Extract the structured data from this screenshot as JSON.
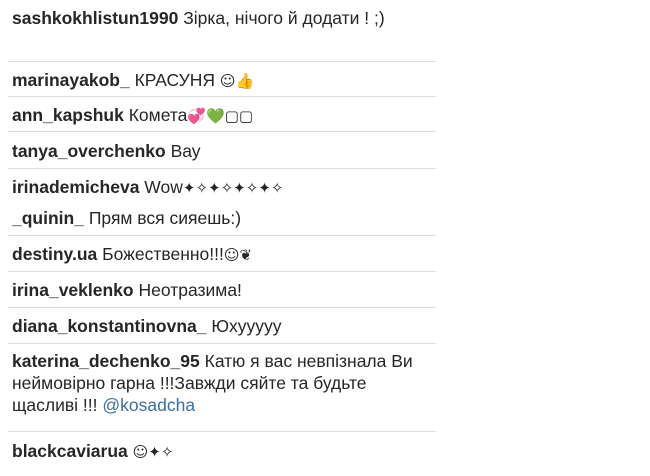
{
  "comments": [
    {
      "user": "sashkokhlistun1990",
      "text": "Зірка, нічого й додати ! ;)",
      "emoji": ""
    },
    {
      "user": "marinayakob_",
      "text": "КРАСУНЯ",
      "emoji": "☺👍"
    },
    {
      "user": "ann_kapshuk",
      "text": "Комета",
      "emoji": "💞💚▢▢"
    },
    {
      "user": "tanya_overchenko",
      "text": "Вау",
      "emoji": ""
    },
    {
      "user": "irinademicheva",
      "text": "Wow",
      "emoji": "✦✧✦✧✦✧✦✧"
    },
    {
      "user": "_quinin_",
      "text": "Прям вся сияешь:)",
      "emoji": ""
    },
    {
      "user": "destiny.ua",
      "text": "Божественно!!!",
      "emoji": "☺❦"
    },
    {
      "user": "irina_veklenko",
      "text": "Неотразима!",
      "emoji": ""
    },
    {
      "user": "diana_konstantinovna_",
      "text": "Юхууууу",
      "emoji": ""
    },
    {
      "user": "katerina_dechenko_95",
      "text": "Катю я вас невпізнала Ви неймовірно гарна !!!Завжди сяйте та будьте щасливі !!!",
      "mention": "@kosadcha",
      "emoji": ""
    },
    {
      "user": "blackcaviarua",
      "text": "",
      "emoji": "☺✦✧"
    }
  ]
}
